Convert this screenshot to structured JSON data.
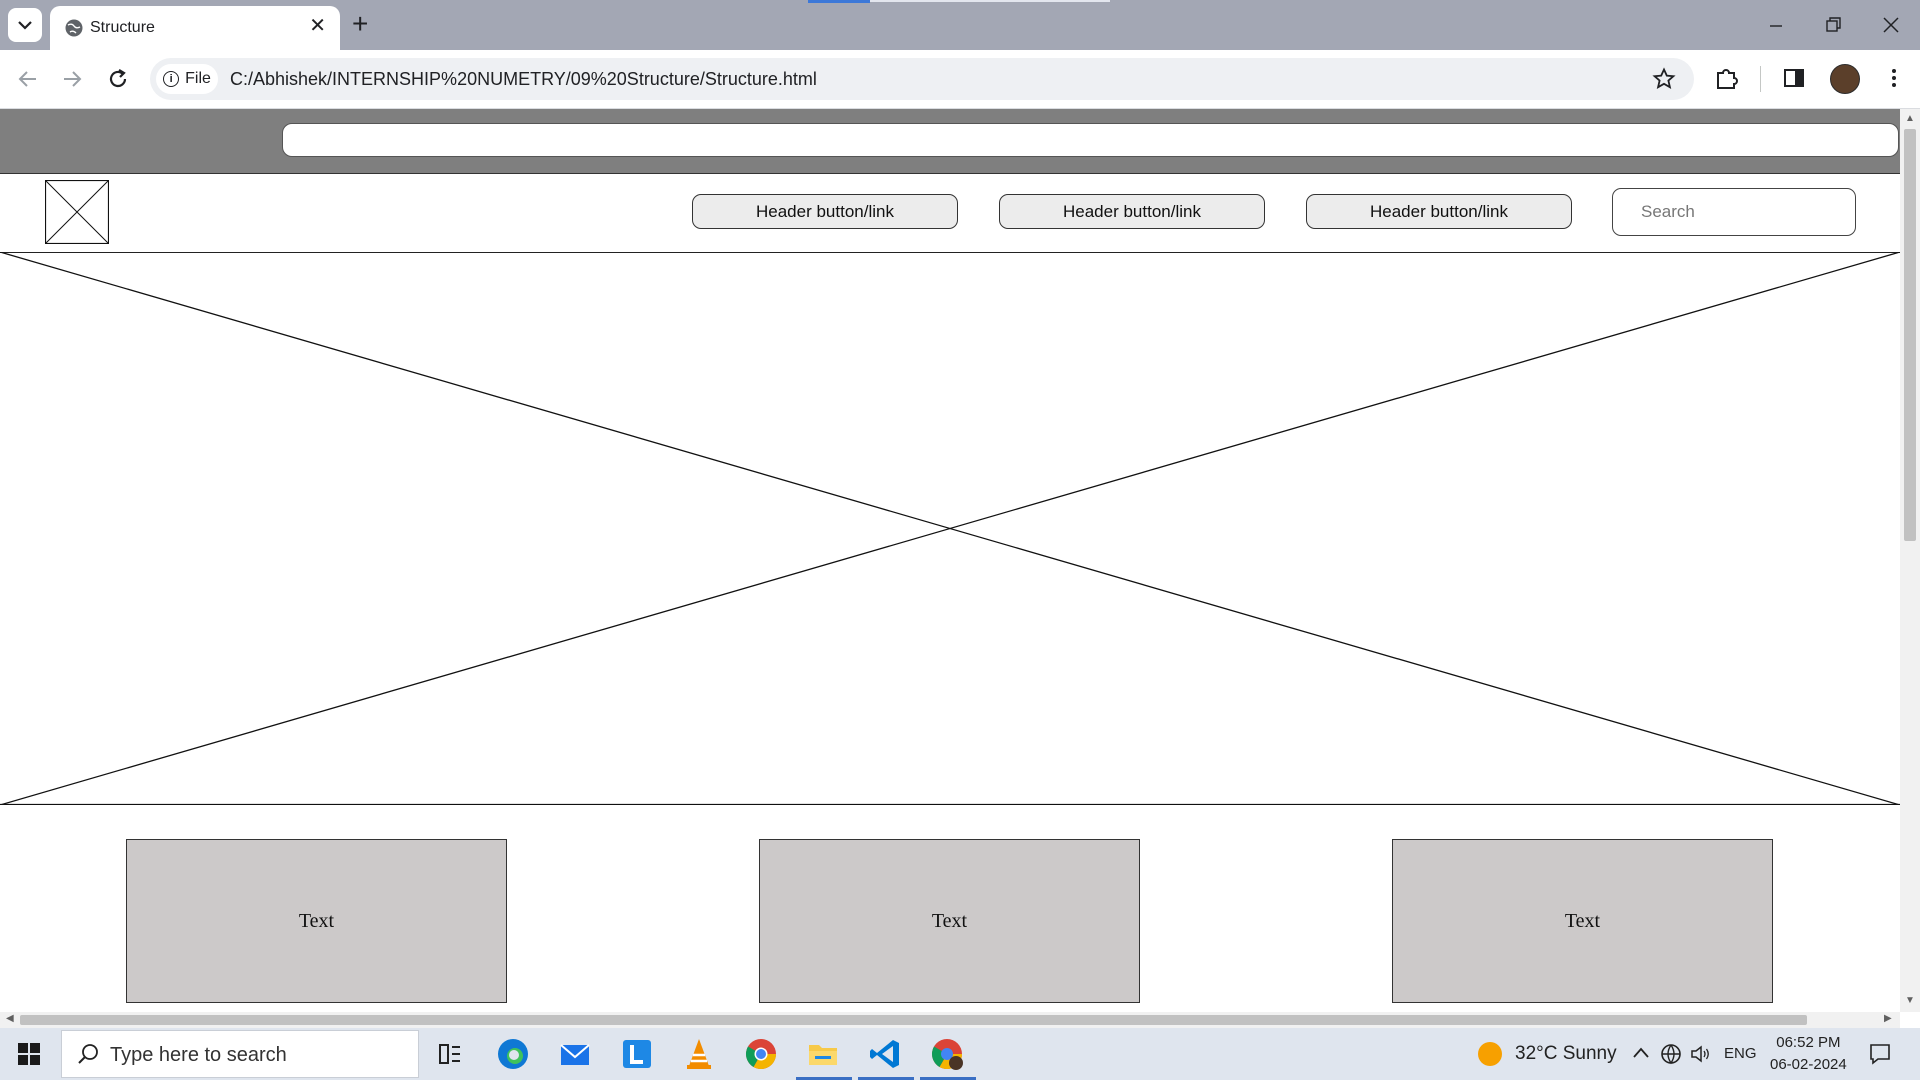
{
  "browser": {
    "tab_title": "Structure",
    "url": "C:/Abhishek/INTERNSHIP%20NUMETRY/09%20Structure/Structure.html",
    "site_chip": "File",
    "icons": [
      "chevron-down-icon",
      "globe-icon",
      "close-icon",
      "plus-icon",
      "minimize-icon",
      "restore-icon",
      "close-window-icon",
      "back-icon",
      "forward-icon",
      "reload-icon",
      "info-icon",
      "star-icon",
      "extensions-icon",
      "side-panel-icon",
      "profile-avatar",
      "more-icon"
    ]
  },
  "page": {
    "topbar_input_value": "",
    "header": {
      "buttons": [
        "Header button/link",
        "Header button/link",
        "Header button/link"
      ],
      "search_placeholder": "Search"
    },
    "cards": [
      "Text",
      "Text",
      "Text"
    ]
  },
  "taskbar": {
    "search_placeholder": "Type here to search",
    "weather": "32°C  Sunny",
    "language": "ENG",
    "time": "06:52 PM",
    "date": "06-02-2024",
    "apps": [
      "task-view-icon",
      "edge-icon",
      "mail-icon",
      "l-app-icon",
      "vlc-icon",
      "chrome-icon",
      "file-explorer-icon",
      "vscode-icon",
      "chrome-profile-icon"
    ]
  }
}
